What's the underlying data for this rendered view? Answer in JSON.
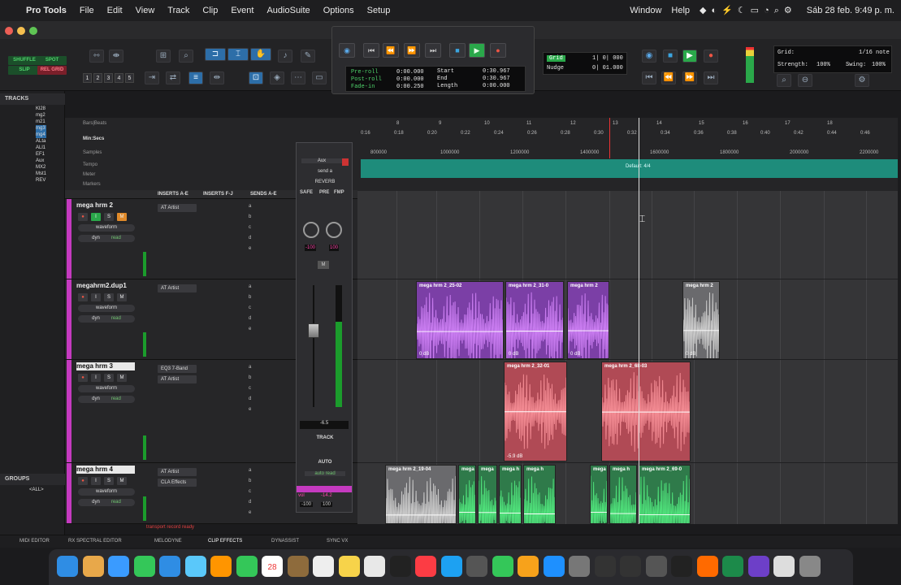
{
  "menubar": {
    "app": "Pro Tools",
    "items": [
      "File",
      "Edit",
      "View",
      "Track",
      "Clip",
      "Event",
      "AudioSuite",
      "Options",
      "Setup",
      "Window",
      "Help"
    ],
    "datetime": "Sáb 28 feb. 9:49 p. m."
  },
  "toolbar": {
    "modes": [
      "SHUFFLE",
      "SPOT",
      "SLIP",
      "REL GRID"
    ],
    "numbers": [
      "1",
      "2",
      "3",
      "4",
      "5"
    ],
    "grid_label": "Grid",
    "grid_value": "1| 0| 000",
    "nudge_label": "Nudge",
    "nudge_value": "0| 01.000",
    "grid2_label": "Grid:",
    "grid2_value": "1/16 note",
    "strength_label": "Strength:",
    "strength_value": "100%",
    "swing_label": "Swing:",
    "swing_value": "100%"
  },
  "transport": {
    "preroll_label": "Pre-roll",
    "preroll": "0:00.000",
    "postroll_label": "Post-roll",
    "postroll": "0:00.000",
    "fadein_label": "Fade-in",
    "fadein": "0:00.250",
    "start_label": "Start",
    "start": "0:30.967",
    "end_label": "End",
    "end": "0:30.967",
    "length_label": "Length",
    "length": "0:00.000"
  },
  "left": {
    "tracks_title": "TRACKS",
    "tracks": [
      "Kl28",
      "mg2",
      "m21",
      "mg3",
      "mg4",
      "ALta",
      "ALl1",
      "EF1",
      "Aux",
      "MX2",
      "Mst1",
      "REV"
    ],
    "groups_title": "GROUPS",
    "groups_all": "<ALL>"
  },
  "rulers": {
    "labels": [
      "Bars|Beats",
      "Min:Secs",
      "Samples",
      "Tempo",
      "Meter",
      "Markers"
    ],
    "bars": [
      "8",
      "9",
      "10",
      "11",
      "12",
      "13",
      "14",
      "15",
      "16",
      "17",
      "18"
    ],
    "mins": [
      "0:16",
      "0:18",
      "0:20",
      "0:22",
      "0:24",
      "0:26",
      "0:28",
      "0:30",
      "0:32",
      "0:34",
      "0:36",
      "0:38",
      "0:40",
      "0:42",
      "0:44",
      "0:46"
    ],
    "samples": [
      "800000",
      "1000000",
      "1200000",
      "1400000",
      "1600000",
      "1800000",
      "2000000",
      "2200000"
    ],
    "meter": "Default: 4/4"
  },
  "columns": {
    "inserts_ae": "INSERTS A-E",
    "inserts_fj": "INSERTS F-J",
    "sends_ae": "SENDS A-E"
  },
  "tracks": [
    {
      "name": "mega hrm 2",
      "insert1": "AT Artist",
      "insert2": "",
      "view": "waveform",
      "dyn": "dyn",
      "mode": "read"
    },
    {
      "name": "megahrm2.dup1",
      "insert1": "AT Artist",
      "insert2": "",
      "view": "waveform",
      "dyn": "dyn",
      "mode": "read"
    },
    {
      "name": "mega hrm 3",
      "insert1": "EQ3 7-Band",
      "insert2": "AT Artist",
      "view": "waveform",
      "dyn": "dyn",
      "mode": "read"
    },
    {
      "name": "mega hrm 4",
      "insert1": "AT Artist",
      "insert2": "CLA Effects",
      "view": "waveform",
      "dyn": "dyn",
      "mode": "read"
    }
  ],
  "sends": [
    "a",
    "b",
    "c",
    "d",
    "e"
  ],
  "mixer": {
    "io": "Aux",
    "send": "send a",
    "bus": "REVERB",
    "safe": "SAFE",
    "pre": "PRE",
    "fmp": "FMP",
    "pan_l": "-100",
    "pan_r": "100",
    "m": "M",
    "vol": "-6.5",
    "track": "TRACK",
    "auto": "AUTO",
    "autoread": "auto read",
    "vol_l": "-100",
    "vol_r": "100",
    "vol_label": "vol",
    "vol_val": "-14.2"
  },
  "clips": [
    {
      "name": "mega hrm 2_25-02",
      "gain": "0 dB"
    },
    {
      "name": "mega hrm 2_31-0",
      "gain": "0 dB"
    },
    {
      "name": "mega hrm 2",
      "gain": "0 dB"
    },
    {
      "name": "mega hrm 2",
      "gain": "0 dB"
    },
    {
      "name": "mega hrm 2_32-01",
      "gain": "-5.9 dB"
    },
    {
      "name": "mega hrm 2_68-03",
      "gain": ""
    },
    {
      "name": "mega hrm 2_19-04",
      "gain": ""
    },
    {
      "name": "mega",
      "gain": ""
    },
    {
      "name": "mega",
      "gain": ""
    },
    {
      "name": "mega h",
      "gain": ""
    },
    {
      "name": "mega h",
      "gain": ""
    },
    {
      "name": "mega",
      "gain": ""
    },
    {
      "name": "mega h",
      "gain": ""
    },
    {
      "name": "mega hrm 2_69-0",
      "gain": ""
    }
  ],
  "status": "transport record ready",
  "bottom": [
    "MIDI EDITOR",
    "RX SPECTRAL EDITOR",
    "MELODYNE",
    "CLIP EFFECTS",
    "DYNASSIST",
    "SYNC VX"
  ],
  "dock_calendar": "28",
  "colors": {
    "track": "#c53ac0",
    "purple_clip": "#7b3fa6",
    "red_clip": "#b04a55",
    "gray_clip": "#6a6a6d",
    "green_clip": "#2f7a4a",
    "tempo": "#1e8c7b",
    "accent": "#2d6ea8"
  }
}
